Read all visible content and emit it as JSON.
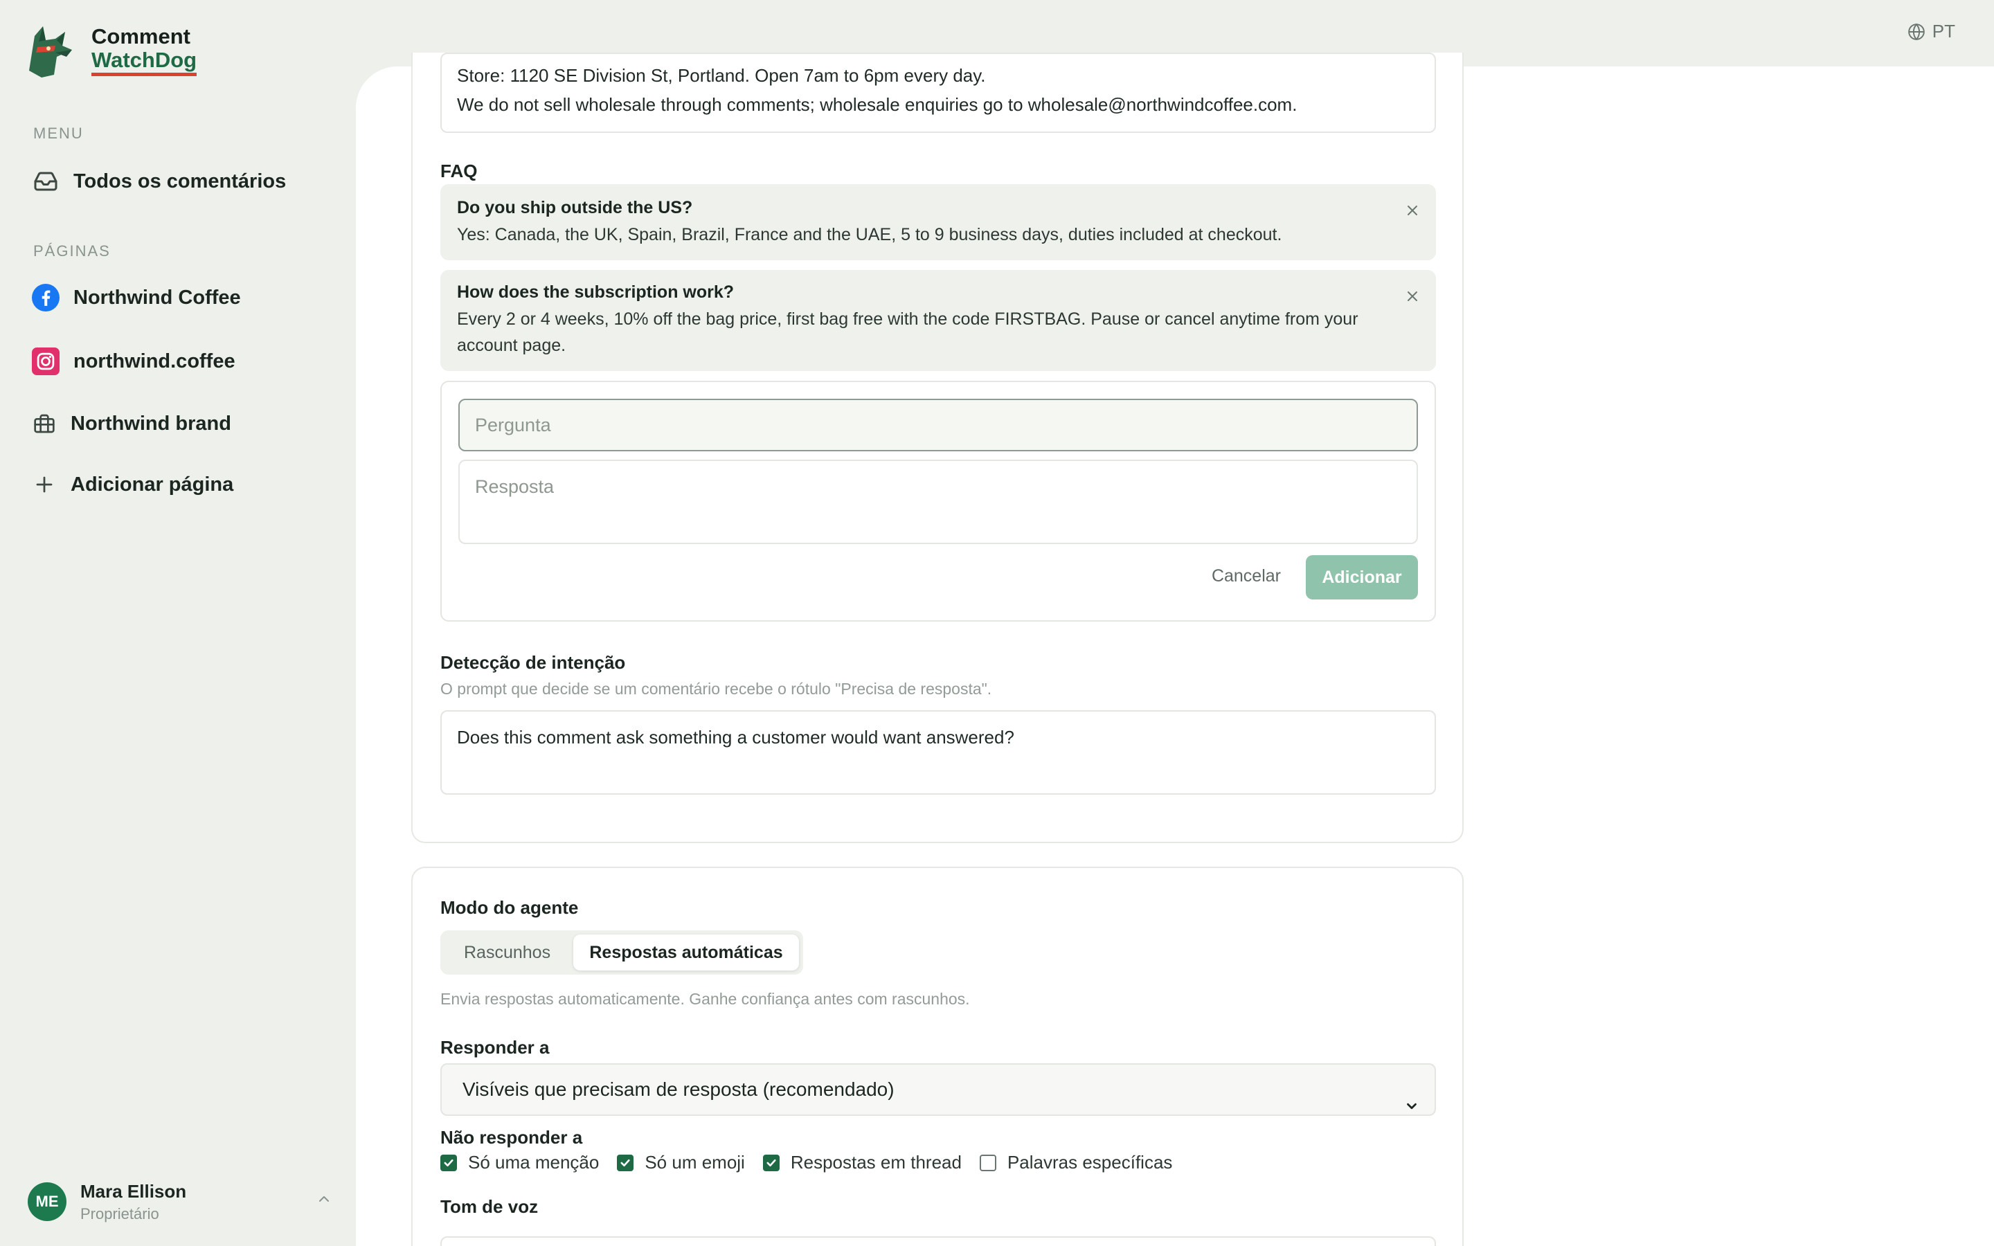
{
  "app": {
    "logo_line1": "Comment",
    "logo_line2": "WatchDog",
    "language": "PT"
  },
  "sidebar": {
    "menu_label": "MENU",
    "all_comments": "Todos os comentários",
    "pages_label": "PÁGINAS",
    "pages": [
      {
        "label": "Northwind Coffee",
        "icon": "facebook-icon"
      },
      {
        "label": "northwind.coffee",
        "icon": "instagram-icon"
      },
      {
        "label": "Northwind brand",
        "icon": "briefcase-icon"
      }
    ],
    "add_page": "Adicionar página",
    "user": {
      "initials": "ME",
      "name": "Mara Ellison",
      "role": "Proprietário"
    }
  },
  "knowledge": {
    "info_line1": "Store: 1120 SE Division St, Portland. Open 7am to 6pm every day.",
    "info_line2": "We do not sell wholesale through comments; wholesale enquiries go to wholesale@northwindcoffee.com.",
    "faq_label": "FAQ",
    "faq": [
      {
        "q": "Do you ship outside the US?",
        "a": "Yes: Canada, the UK, Spain, Brazil, France and the UAE, 5 to 9 business days, duties included at checkout."
      },
      {
        "q": "How does the subscription work?",
        "a": "Every 2 or 4 weeks, 10% off the bag price, first bag free with the code FIRSTBAG. Pause or cancel anytime from your account page."
      }
    ],
    "question_placeholder": "Pergunta",
    "answer_placeholder": "Resposta",
    "cancel": "Cancelar",
    "add": "Adicionar",
    "intent_label": "Detecção de intenção",
    "intent_help": "O prompt que decide se um comentário recebe o rótulo \"Precisa de resposta\".",
    "intent_prompt": "Does this comment ask something a customer would want answered?"
  },
  "agent": {
    "mode_label": "Modo do agente",
    "mode_drafts": "Rascunhos",
    "mode_auto": "Respostas automáticas",
    "mode_help": "Envia respostas automaticamente. Ganhe confiança antes com rascunhos.",
    "reply_to_label": "Responder a",
    "reply_to_value": "Visíveis que precisam de resposta (recomendado)",
    "dont_reply_label": "Não responder a",
    "exclusions": [
      {
        "label": "Só uma menção",
        "checked": true
      },
      {
        "label": "Só um emoji",
        "checked": true
      },
      {
        "label": "Respostas em thread",
        "checked": true
      },
      {
        "label": "Palavras específicas",
        "checked": false
      }
    ],
    "tone_label": "Tom de voz"
  },
  "colors": {
    "brand_green": "#1d6a45",
    "accent_red": "#d9432f",
    "add_button": "#8fc3ab"
  }
}
